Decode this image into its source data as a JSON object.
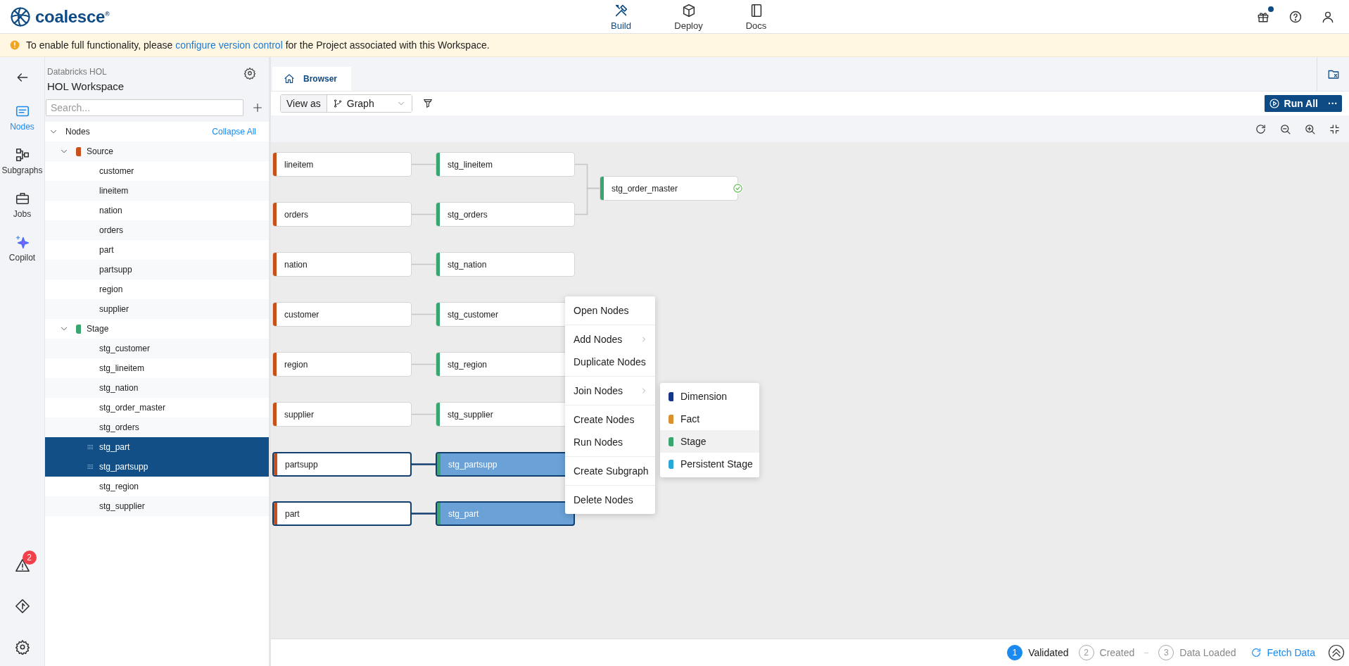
{
  "brand": "coalesce$^{®}$",
  "top_nav": [
    {
      "label": "Build",
      "selected": true
    },
    {
      "label": "Deploy",
      "selected": false
    },
    {
      "label": "Docs",
      "selected": false
    }
  ],
  "header_actions": {
    "gift_has_notification": true
  },
  "banner": {
    "text_before": "To enable full functionality, please",
    "link": "configure version control",
    "text_after": "for the Project associated with this Workspace."
  },
  "nav_rail": {
    "items": [
      {
        "label": "Nodes",
        "selected": true
      },
      {
        "label": "Subgraphs",
        "selected": false
      },
      {
        "label": "Jobs",
        "selected": false
      },
      {
        "label": "Copilot",
        "selected": false
      }
    ],
    "problems_badge": "2"
  },
  "sidebar": {
    "project": "Databricks HOL",
    "workspace": "HOL Workspace",
    "search": {
      "placeholder": "Search..."
    },
    "tree": {
      "label": "Nodes",
      "expanded": true,
      "action": "Collapse All",
      "children": [
        {
          "label": "Source",
          "color": "#c8501a",
          "expanded": true,
          "children": [
            {
              "label": "customer",
              "selected": false
            },
            {
              "label": "lineitem",
              "selected": false
            },
            {
              "label": "nation",
              "selected": false
            },
            {
              "label": "orders",
              "selected": false
            },
            {
              "label": "part",
              "selected": false
            },
            {
              "label": "partsupp",
              "selected": false
            },
            {
              "label": "region",
              "selected": false
            },
            {
              "label": "supplier",
              "selected": false
            }
          ]
        },
        {
          "label": "Stage",
          "color": "#3aa66f",
          "expanded": true,
          "children": [
            {
              "label": "stg_customer",
              "selected": false
            },
            {
              "label": "stg_lineitem",
              "selected": false
            },
            {
              "label": "stg_nation",
              "selected": false
            },
            {
              "label": "stg_order_master",
              "selected": false
            },
            {
              "label": "stg_orders",
              "selected": false
            },
            {
              "label": "stg_part",
              "selected": true
            },
            {
              "label": "stg_partsupp",
              "selected": true
            },
            {
              "label": "stg_region",
              "selected": false
            },
            {
              "label": "stg_supplier",
              "selected": false
            }
          ]
        }
      ]
    }
  },
  "tabs": [
    {
      "label": "Browser",
      "selected": true
    }
  ],
  "toolbar": {
    "view_as_label": "View as",
    "view": "Graph",
    "run_button": "Run All",
    "more_button": "···"
  },
  "graph": {
    "nodes": [
      {
        "label": "lineitem",
        "kind": "source",
        "selected": false
      },
      {
        "label": "stg_lineitem",
        "kind": "stage",
        "selected": false
      },
      {
        "label": "stg_order_master",
        "kind": "stage",
        "selected": false,
        "validated": true
      },
      {
        "label": "orders",
        "kind": "source",
        "selected": false
      },
      {
        "label": "stg_orders",
        "kind": "stage",
        "selected": false
      },
      {
        "label": "nation",
        "kind": "source",
        "selected": false
      },
      {
        "label": "stg_nation",
        "kind": "stage",
        "selected": false
      },
      {
        "label": "customer",
        "kind": "source",
        "selected": false
      },
      {
        "label": "stg_customer",
        "kind": "stage",
        "selected": false
      },
      {
        "label": "region",
        "kind": "source",
        "selected": false
      },
      {
        "label": "stg_region",
        "kind": "stage",
        "selected": false
      },
      {
        "label": "supplier",
        "kind": "source",
        "selected": false
      },
      {
        "label": "stg_supplier",
        "kind": "stage",
        "selected": false
      },
      {
        "label": "partsupp",
        "kind": "source",
        "selected": true
      },
      {
        "label": "stg_partsupp",
        "kind": "stage",
        "selected": true
      },
      {
        "label": "part",
        "kind": "source",
        "selected": true
      },
      {
        "label": "stg_part",
        "kind": "stage",
        "selected": true
      }
    ]
  },
  "context_menu": {
    "groups": [
      [
        {
          "label": "Open Nodes",
          "submenu": false
        }
      ],
      [
        {
          "label": "Add Nodes",
          "submenu": true
        },
        {
          "label": "Duplicate Nodes",
          "submenu": false
        }
      ],
      [
        {
          "label": "Join Nodes",
          "submenu": true
        }
      ],
      [
        {
          "label": "Create Nodes",
          "submenu": false
        },
        {
          "label": "Run Nodes",
          "submenu": false
        }
      ],
      [
        {
          "label": "Create Subgraph",
          "submenu": false
        }
      ],
      [
        {
          "label": "Delete Nodes",
          "submenu": false
        }
      ]
    ],
    "submenu": [
      {
        "label": "Dimension",
        "color": "#17358a",
        "selected": false
      },
      {
        "label": "Fact",
        "color": "#d8912c",
        "selected": false
      },
      {
        "label": "Stage",
        "color": "#3aa66f",
        "selected": true
      },
      {
        "label": "Persistent Stage",
        "color": "#2aa7d9",
        "selected": false
      }
    ]
  },
  "status_bar": {
    "steps": [
      {
        "number": "1",
        "label": "Validated",
        "done": true
      },
      {
        "number": "2",
        "label": "Created",
        "done": false
      },
      {
        "number": "3",
        "label": "Data Loaded",
        "done": false
      }
    ],
    "fetch": "Fetch Data"
  }
}
